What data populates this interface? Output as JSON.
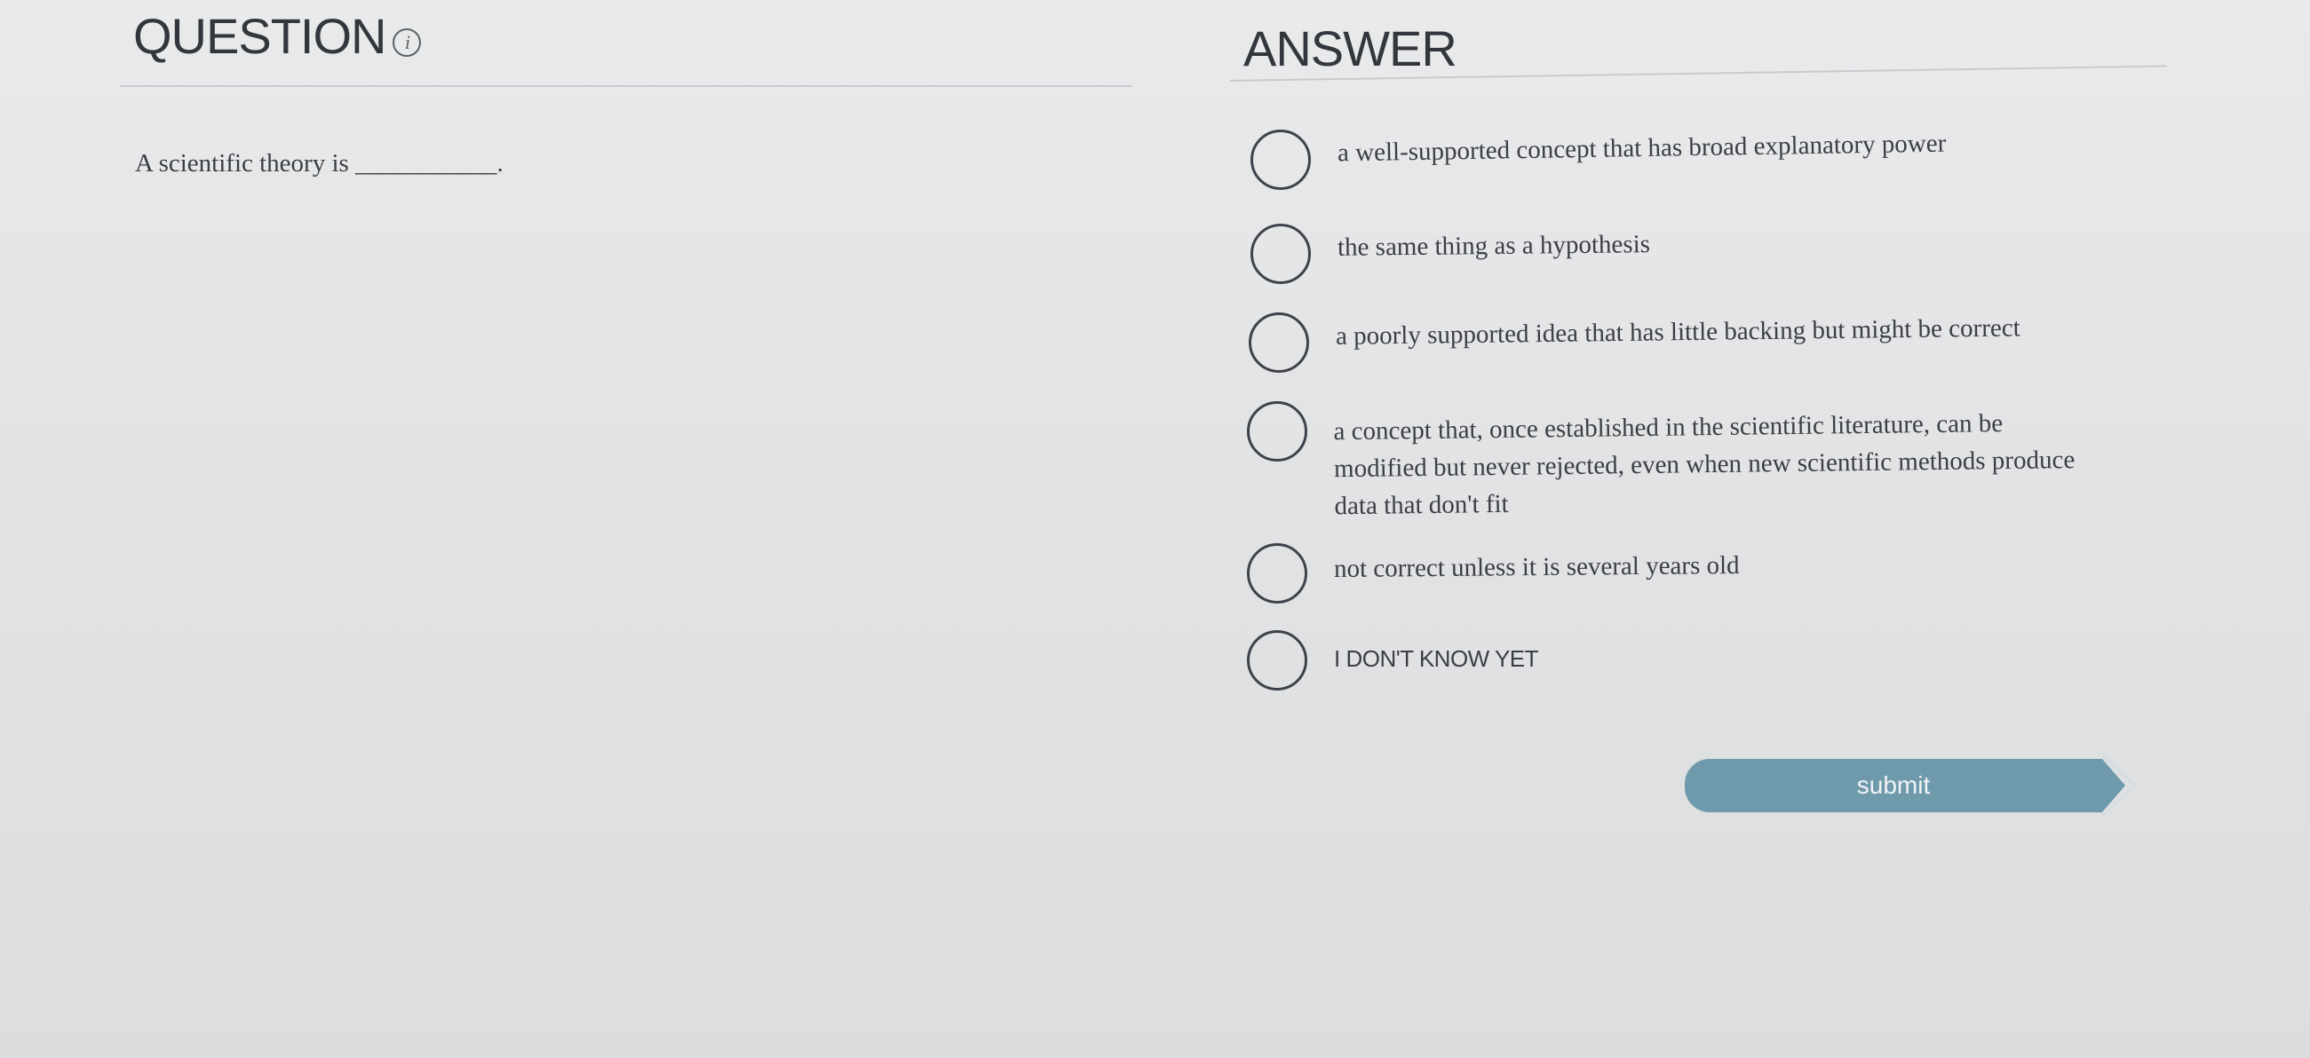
{
  "question_panel": {
    "header": "QUESTION",
    "info_icon": "info-circle-icon",
    "text": "A scientific theory is ___________."
  },
  "answer_panel": {
    "header": "ANSWER",
    "options": [
      {
        "label": "a well-supported concept that has broad explanatory power",
        "selected": false
      },
      {
        "label": "the same thing as a hypothesis",
        "selected": false
      },
      {
        "label": "a poorly supported idea that has little backing but might be correct",
        "selected": false
      },
      {
        "label": "a concept that, once established in the scientific literature, can be modified but never rejected, even when new scientific methods produce data that don't fit",
        "selected": false
      },
      {
        "label": "not correct unless it is several years old",
        "selected": false
      },
      {
        "label": "I DON'T KNOW YET",
        "selected": false
      }
    ]
  },
  "submit": {
    "label": "submit",
    "color": "#6f9aac"
  }
}
